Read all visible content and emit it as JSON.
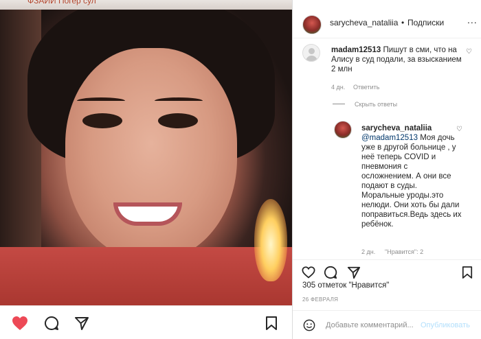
{
  "photo": {
    "caption_fragment": "ФЗАЙИ Погер сул"
  },
  "left_actions": {
    "like_icon": "heart-filled-icon",
    "comment_icon": "comment-icon",
    "share_icon": "share-icon",
    "save_icon": "bookmark-icon",
    "like_color": "#ed4956"
  },
  "header": {
    "username": "sarycheva_nataliia",
    "separator": "•",
    "follow_label": "Подписки",
    "more_label": "..."
  },
  "comments": [
    {
      "username": "madam12513",
      "text": "Пишут в сми, что на Алису в суд подали, за взысканием 2 млн",
      "time": "4 дн.",
      "reply_label": "Ответить"
    }
  ],
  "hide_replies_label": "Скрыть ответы",
  "reply": {
    "username": "sarycheva_nataliia",
    "mention": "@madam12513",
    "text": "Моя дочь уже в другой больнице , у неё теперь COVID и пневмония с осложнением. А они все подают в суды. Моральные уроды.это нелюди. Они хоть бы дали поправиться.Ведь здесь их ребёнок.",
    "time": "2 дн.",
    "likes_label": "\"Нравится\": 2"
  },
  "post": {
    "likes_text": "305 отметок \"Нравится\"",
    "date": "26 ФЕВРАЛЯ"
  },
  "add_comment": {
    "placeholder": "Добавьте комментарий...",
    "publish_label": "Опубликовать",
    "emoji_icon": "smiley-icon"
  },
  "colors": {
    "accent_link": "#00376b",
    "publish_disabled": "#b2dffc",
    "muted": "#8e8e8e"
  }
}
